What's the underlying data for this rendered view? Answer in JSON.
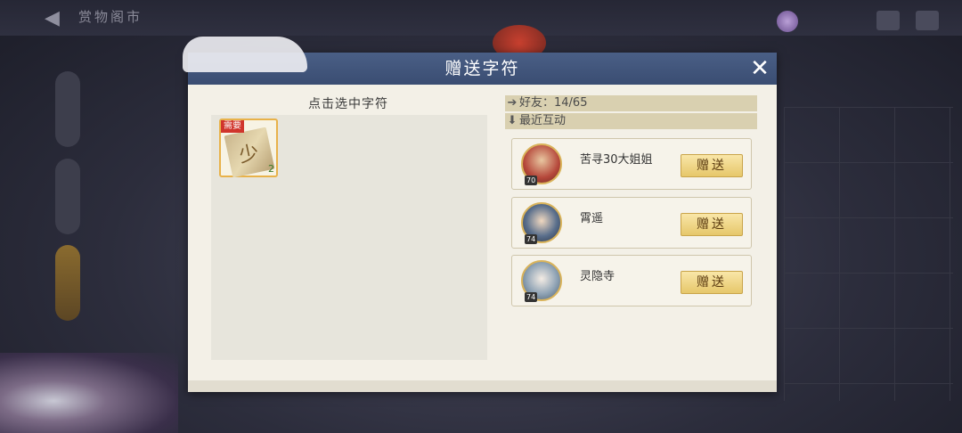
{
  "background": {
    "title": "赏物阁市",
    "currency_icon": "jade-coin-icon"
  },
  "dialog": {
    "title": "赠送字符",
    "close_icon": "close-icon",
    "left_heading": "点击选中字符",
    "runes": [
      {
        "tag": "需要",
        "glyph": "少",
        "count": "2",
        "icon": "rune-scroll-icon"
      }
    ],
    "friends_label": "好友：14/65",
    "recent_label": "最近互动",
    "friends": [
      {
        "name": "苦寻30大姐姐",
        "level": "70",
        "avatar_color": "#b5473a",
        "gift_label": "赠送"
      },
      {
        "name": "霄遥",
        "level": "74",
        "avatar_color": "#5a6f8c",
        "gift_label": "赠送"
      },
      {
        "name": "灵隐寺",
        "level": "74",
        "avatar_color": "#8fa3b5",
        "gift_label": "赠送"
      }
    ]
  }
}
